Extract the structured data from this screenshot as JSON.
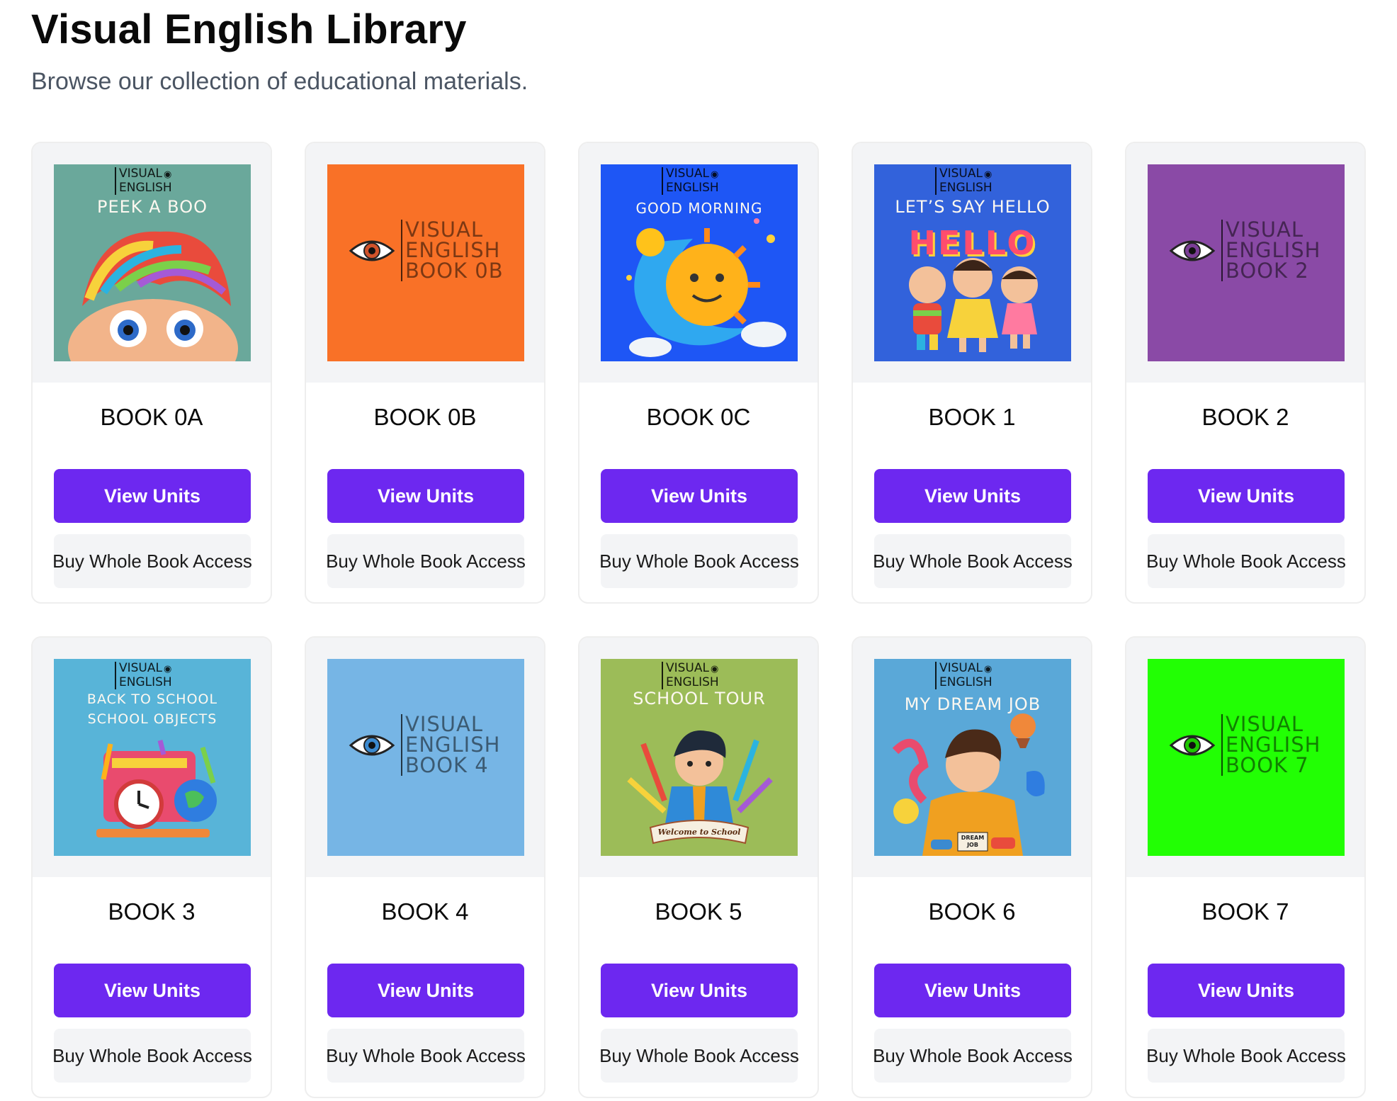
{
  "header": {
    "title": "Visual English Library",
    "subtitle": "Browse our collection of educational materials."
  },
  "cover_brand": {
    "line1": "VISUAL",
    "line2": "ENGLISH"
  },
  "books": [
    {
      "title": "BOOK 0A",
      "cover_style": "illustrated",
      "cover_bg": "#6aa89b",
      "cover_text": "PEEK A BOO",
      "cover_text2": "",
      "view_label": "View Units",
      "buy_label": "Buy Whole Book Access"
    },
    {
      "title": "BOOK 0B",
      "cover_style": "plain",
      "cover_bg": "#f97127",
      "cover_text": "BOOK 0B",
      "cover_text2": "",
      "view_label": "View Units",
      "buy_label": "Buy Whole Book Access"
    },
    {
      "title": "BOOK 0C",
      "cover_style": "illustrated",
      "cover_bg": "#1e56f5",
      "cover_text": "GOOD MORNING",
      "cover_text2": "",
      "view_label": "View Units",
      "buy_label": "Buy Whole Book Access"
    },
    {
      "title": "BOOK 1",
      "cover_style": "illustrated",
      "cover_bg": "#3262db",
      "cover_text": "LET’S SAY HELLO",
      "cover_text2": "HELLO",
      "view_label": "View Units",
      "buy_label": "Buy Whole Book Access"
    },
    {
      "title": "BOOK 2",
      "cover_style": "plain",
      "cover_bg": "#8a4aa6",
      "cover_text": "BOOK 2",
      "cover_text2": "",
      "view_label": "View Units",
      "buy_label": "Buy Whole Book Access"
    },
    {
      "title": "BOOK 3",
      "cover_style": "illustrated",
      "cover_bg": "#58b4d8",
      "cover_text": "BACK TO SCHOOL",
      "cover_text2": "SCHOOL OBJECTS",
      "view_label": "View Units",
      "buy_label": "Buy Whole Book Access"
    },
    {
      "title": "BOOK 4",
      "cover_style": "plain",
      "cover_bg": "#76b5e5",
      "cover_text": "BOOK 4",
      "cover_text2": "",
      "view_label": "View Units",
      "buy_label": "Buy Whole Book Access"
    },
    {
      "title": "BOOK 5",
      "cover_style": "illustrated",
      "cover_bg": "#9cbc58",
      "cover_text": "SCHOOL TOUR",
      "cover_text2": "Welcome to School",
      "view_label": "View Units",
      "buy_label": "Buy Whole Book Access"
    },
    {
      "title": "BOOK 6",
      "cover_style": "illustrated",
      "cover_bg": "#5aa8d8",
      "cover_text": "MY DREAM JOB",
      "cover_text2": "DREAM JOB",
      "view_label": "View Units",
      "buy_label": "Buy Whole Book Access"
    },
    {
      "title": "BOOK 7",
      "cover_style": "plain",
      "cover_bg": "#22ff04",
      "cover_text": "BOOK 7",
      "cover_text2": "",
      "view_label": "View Units",
      "buy_label": "Buy Whole Book Access"
    }
  ],
  "colors": {
    "primary_button": "#6d28f0",
    "secondary_button": "#f3f4f6",
    "card_border": "#eeeeee"
  }
}
